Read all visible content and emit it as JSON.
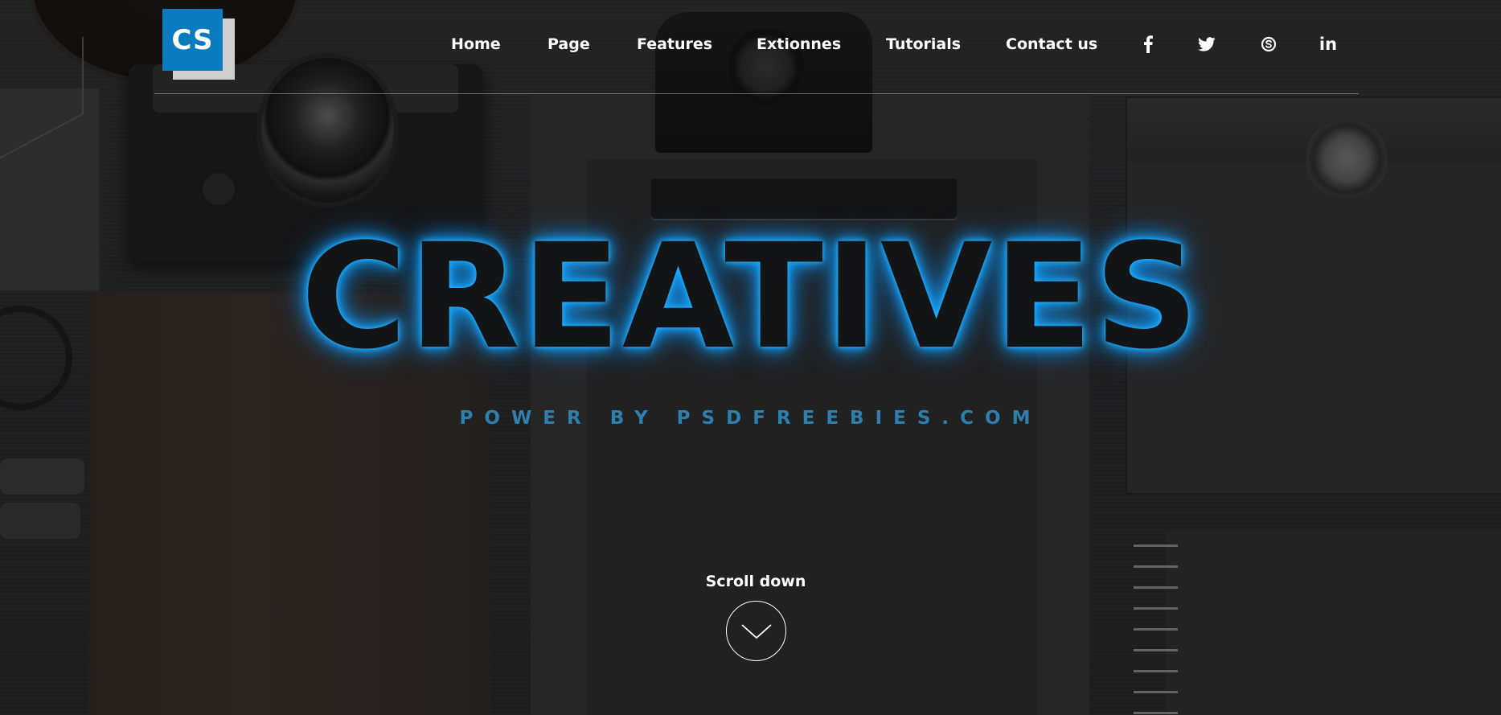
{
  "logo": {
    "text": "CS"
  },
  "nav": {
    "items": [
      {
        "label": "Home"
      },
      {
        "label": "Page"
      },
      {
        "label": "Features"
      },
      {
        "label": "Extionnes"
      },
      {
        "label": "Tutorials"
      },
      {
        "label": "Contact us"
      }
    ],
    "social": [
      {
        "icon": "facebook-icon",
        "glyph": "f"
      },
      {
        "icon": "twitter-icon",
        "glyph": ""
      },
      {
        "icon": "skype-icon",
        "glyph": ""
      },
      {
        "icon": "linkedin-icon",
        "glyph": "in"
      }
    ]
  },
  "hero": {
    "title": "CREATIVES",
    "subtitle": "POWER BY PSDFREEBIES.COM"
  },
  "scroll": {
    "label": "Scroll down",
    "icon": "chevron-down-icon"
  },
  "colors": {
    "accent": "#0a7bbf",
    "glow": "#1aa6ff",
    "subtitle": "#2d7fae"
  }
}
